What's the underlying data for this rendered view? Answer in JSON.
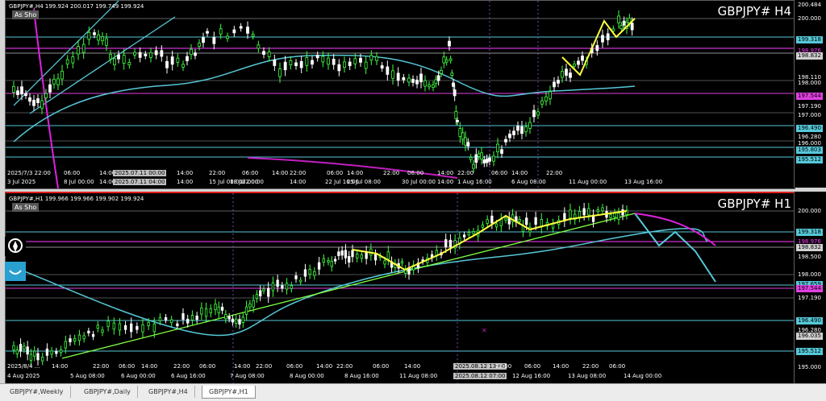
{
  "top_chart": {
    "info": "GBPJPY#,H4  199.924 200.017 199.749 199.924",
    "title": "GBPJPY#  H4",
    "as_show": "As Sho",
    "price_labels": [
      {
        "text": "200.484",
        "color": "#ffffff",
        "bg": "#000000"
      },
      {
        "text": "200.000",
        "color": "#ffffff",
        "bg": "#000000"
      },
      {
        "text": "199.318",
        "color": "#000000",
        "bg": "#56c8d8"
      },
      {
        "text": "198.976",
        "color": "#ff3cff",
        "bg": "#000000"
      },
      {
        "text": "198.832",
        "color": "#000000",
        "bg": "#d0d0d0"
      },
      {
        "text": "198.110",
        "color": "#ffffff",
        "bg": "#000000"
      },
      {
        "text": "198.000",
        "color": "#ffffff",
        "bg": "#000000"
      },
      {
        "text": "197.544",
        "color": "#000000",
        "bg": "#e040e0"
      },
      {
        "text": "197.190",
        "color": "#ffffff",
        "bg": "#000000"
      },
      {
        "text": "197.000",
        "color": "#ffffff",
        "bg": "#000000"
      },
      {
        "text": "196.490",
        "color": "#000000",
        "bg": "#56c8d8"
      },
      {
        "text": "196.280",
        "color": "#ffffff",
        "bg": "#000000"
      },
      {
        "text": "196.000",
        "color": "#ffffff",
        "bg": "#000000"
      },
      {
        "text": "195.803",
        "color": "#000000",
        "bg": "#56c8d8"
      },
      {
        "text": "195.512",
        "color": "#000000",
        "bg": "#56c8d8"
      }
    ],
    "time_labels": [
      "3 Jul 2025",
      "8 Jul 00:00",
      "14:00",
      "2025.07.11 04:00",
      "14:00",
      "15 Jul 08:00",
      "22:00",
      "18 Jul 00:00",
      "14:00",
      "22 Jul 16:00",
      "25 Jul 08:00",
      "30 Jul 00:00",
      "14:00",
      "1 Aug 16:00",
      "6 Aug 08:00",
      "11 Aug 00:00",
      "13 Aug 16:00"
    ],
    "crosshair_top": [
      "2025/7/3 22:00",
      "06:00",
      "14:00",
      "2025.07.11 00:00",
      "14:00",
      "22:00",
      "06:00",
      "14:00",
      "22:00",
      "06:00",
      "14:00",
      "22:00",
      "06:00",
      "14:00",
      "22:00",
      "06:00",
      "14:00",
      "22:00"
    ]
  },
  "bottom_chart": {
    "info": "GBPJPY#,H1  199.966 199.966 199.902 199.924",
    "title": "GBPJPY#  H1",
    "as_show": "As Sho",
    "price_labels": [
      {
        "text": "200.000",
        "color": "#ffffff",
        "bg": "#000000"
      },
      {
        "text": "199.318",
        "color": "#000000",
        "bg": "#56c8d8"
      },
      {
        "text": "198.976",
        "color": "#ff3cff",
        "bg": "#000000"
      },
      {
        "text": "198.832",
        "color": "#000000",
        "bg": "#d0d0d0"
      },
      {
        "text": "198.500",
        "color": "#ffffff",
        "bg": "#000000"
      },
      {
        "text": "198.000",
        "color": "#ffffff",
        "bg": "#000000"
      },
      {
        "text": "197.659",
        "color": "#000000",
        "bg": "#56c8d8"
      },
      {
        "text": "197.544",
        "color": "#000000",
        "bg": "#e040e0"
      },
      {
        "text": "197.190",
        "color": "#ffffff",
        "bg": "#000000"
      },
      {
        "text": "196.490",
        "color": "#000000",
        "bg": "#56c8d8"
      },
      {
        "text": "196.280",
        "color": "#ffffff",
        "bg": "#000000"
      },
      {
        "text": "196.035",
        "color": "#000000",
        "bg": "#d0d0d0"
      },
      {
        "text": "195.512",
        "color": "#000000",
        "bg": "#56c8d8"
      },
      {
        "text": "195.000",
        "color": "#ffffff",
        "bg": "#000000"
      }
    ],
    "time_labels": [
      "4 Aug 2025",
      "5 Aug 08:00",
      "6 Aug 00:00",
      "6 Aug 16:00",
      "7 Aug 08:00",
      "8 Aug 00:00",
      "8 Aug 16:00",
      "11 Aug 08:00",
      "2025.08.12 07:00",
      "12 Aug 16:00",
      "13 Aug 08:00",
      "14 Aug 00:00"
    ],
    "crosshair_top": [
      "2025/8/4 ...",
      "14:00",
      "22:00",
      "06:00",
      "14:00",
      "22:00",
      "06:00",
      "14:00",
      "22:00",
      "06:00",
      "14:00",
      "22:00",
      "06:00",
      "14:00",
      "2025.08.12 13:00",
      "22:00",
      "06:00",
      "14:00",
      "22:00",
      "06:00"
    ]
  },
  "tabs": [
    {
      "label": "GBPJPY#,Weekly",
      "active": false
    },
    {
      "label": "GBPJPY#,Daily",
      "active": false
    },
    {
      "label": "GBPJPY#,H4",
      "active": false
    },
    {
      "label": "GBPJPY#,H1",
      "active": true
    }
  ],
  "colors": {
    "cyan": "#56c8d8",
    "magenta": "#e040e0",
    "yellow": "#ffff40",
    "green": "#40ff40",
    "lime": "#a0ff40"
  }
}
